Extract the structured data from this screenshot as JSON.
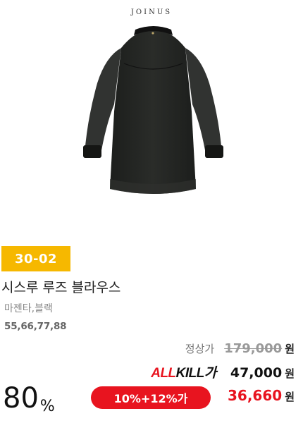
{
  "brand": {
    "name": "JOINUS"
  },
  "product": {
    "code": "30-02",
    "name": "시스루 루즈 블라우스",
    "colors": "마젠타,블랙",
    "sizes": "55,66,77,88",
    "image_icon": "black-blouse-image"
  },
  "pricing": {
    "regular_label": "정상가",
    "regular_price": "179,000",
    "allkill_label_prefix": "ALL",
    "allkill_label_suffix": "KILL가",
    "allkill_price": "47,000",
    "coupon_label": "10%+12%가",
    "final_price": "36,660",
    "currency": "원",
    "discount_rate": "80",
    "discount_unit": "%"
  },
  "colors": {
    "accent_red": "#e8141f",
    "badge_yellow": "#f6b800"
  }
}
